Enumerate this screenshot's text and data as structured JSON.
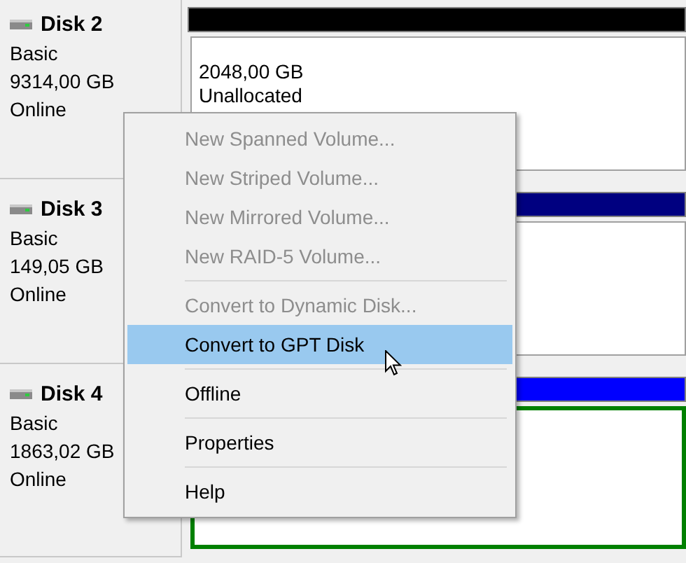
{
  "disks": [
    {
      "name": "Disk 2",
      "type": "Basic",
      "size": "9314,00 GB",
      "status": "Online",
      "color": "#000000",
      "volume": {
        "size": "2048,00 GB",
        "status": "Unallocated"
      }
    },
    {
      "name": "Disk 3",
      "type": "Basic",
      "size": "149,05 GB",
      "status": "Online",
      "color": "#000080"
    },
    {
      "name": "Disk 4",
      "type": "Basic",
      "size": "1863,02 GB",
      "status": "Online",
      "color": "#0000ff",
      "volume": {
        "color": "#008000"
      }
    }
  ],
  "context_menu": {
    "items": [
      {
        "kind": "item",
        "label": "New Spanned Volume...",
        "disabled": true,
        "selected": false
      },
      {
        "kind": "item",
        "label": "New Striped Volume...",
        "disabled": true,
        "selected": false
      },
      {
        "kind": "item",
        "label": "New Mirrored Volume...",
        "disabled": true,
        "selected": false
      },
      {
        "kind": "item",
        "label": "New RAID-5 Volume...",
        "disabled": true,
        "selected": false
      },
      {
        "kind": "separator"
      },
      {
        "kind": "item",
        "label": "Convert to Dynamic Disk...",
        "disabled": true,
        "selected": false
      },
      {
        "kind": "item",
        "label": "Convert to GPT Disk",
        "disabled": false,
        "selected": true
      },
      {
        "kind": "separator"
      },
      {
        "kind": "item",
        "label": "Offline",
        "disabled": false,
        "selected": false
      },
      {
        "kind": "separator"
      },
      {
        "kind": "item",
        "label": "Properties",
        "disabled": false,
        "selected": false
      },
      {
        "kind": "separator"
      },
      {
        "kind": "item",
        "label": "Help",
        "disabled": false,
        "selected": false
      }
    ]
  }
}
